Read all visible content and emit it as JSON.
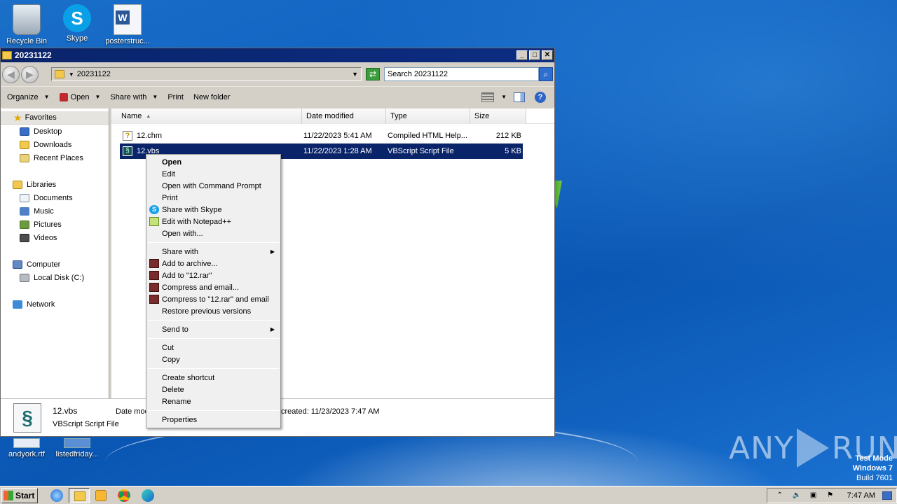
{
  "desktop": {
    "icons": [
      {
        "label": "Recycle Bin"
      },
      {
        "label": "Skype"
      },
      {
        "label": "posterstruc..."
      },
      {
        "label": "andyork.rtf"
      },
      {
        "label": "listedfriday..."
      }
    ]
  },
  "window": {
    "title": "20231122",
    "controls": {
      "minimize": "_",
      "maximize": "□",
      "close": "✕"
    },
    "address": {
      "path": "20231122"
    },
    "search": {
      "placeholder": "Search 20231122"
    },
    "toolbar": {
      "organize": "Organize",
      "open": "Open",
      "share_with": "Share with",
      "print": "Print",
      "new_folder": "New folder"
    },
    "nav": {
      "favorites": "Favorites",
      "desktop": "Desktop",
      "downloads": "Downloads",
      "recent_places": "Recent Places",
      "libraries": "Libraries",
      "documents": "Documents",
      "music": "Music",
      "pictures": "Pictures",
      "videos": "Videos",
      "computer": "Computer",
      "local_disk": "Local Disk (C:)",
      "network": "Network"
    },
    "columns": {
      "name": "Name",
      "date_modified": "Date modified",
      "type": "Type",
      "size": "Size"
    },
    "files": [
      {
        "name": "12.chm",
        "date": "11/22/2023 5:41 AM",
        "type": "Compiled HTML Help...",
        "size": "212 KB",
        "selected": false
      },
      {
        "name": "12.vbs",
        "date": "11/22/2023 1:28 AM",
        "type": "VBScript Script File",
        "size": "5 KB",
        "selected": true
      }
    ],
    "details": {
      "name": "12.vbs",
      "type": "VBScript Script File",
      "date_label": "Date mod",
      "created": "created: 11/23/2023 7:47 AM"
    }
  },
  "context_menu": {
    "open": "Open",
    "edit": "Edit",
    "open_cmd": "Open with Command Prompt",
    "print": "Print",
    "share_skype": "Share with Skype",
    "edit_npp": "Edit with Notepad++",
    "open_with": "Open with...",
    "share_with": "Share with",
    "add_archive": "Add to archive...",
    "add_rar": "Add to \"12.rar\"",
    "compress_email": "Compress and email...",
    "compress_rar_email": "Compress to \"12.rar\" and email",
    "restore": "Restore previous versions",
    "send_to": "Send to",
    "cut": "Cut",
    "copy": "Copy",
    "create_shortcut": "Create shortcut",
    "delete": "Delete",
    "rename": "Rename",
    "properties": "Properties"
  },
  "watermark": {
    "left": "ANY",
    "right": "RUN"
  },
  "test_mode": {
    "line1": "Test Mode",
    "line2": "Windows 7",
    "line3": "Build 7601"
  },
  "taskbar": {
    "start": "Start",
    "clock": "7:47 AM"
  }
}
